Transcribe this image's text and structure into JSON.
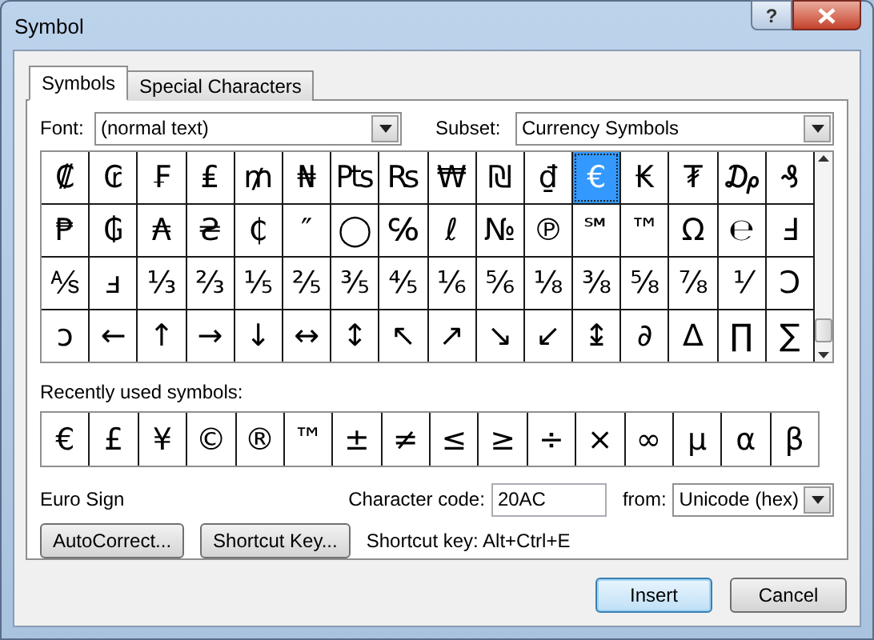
{
  "window": {
    "title": "Symbol",
    "help_button": "?"
  },
  "tabs": [
    {
      "label": "Symbols",
      "selected": true
    },
    {
      "label": "Special Characters",
      "selected": false
    }
  ],
  "font": {
    "label": "Font:",
    "value": "(normal text)"
  },
  "subset": {
    "label": "Subset:",
    "value": "Currency Symbols"
  },
  "symbols": [
    {
      "char": "₡",
      "selected": false
    },
    {
      "char": "₢",
      "selected": false
    },
    {
      "char": "₣",
      "selected": false
    },
    {
      "char": "₤",
      "selected": false
    },
    {
      "char": "₥",
      "selected": false
    },
    {
      "char": "₦",
      "selected": false
    },
    {
      "char": "₧",
      "selected": false
    },
    {
      "char": "₨",
      "selected": false
    },
    {
      "char": "₩",
      "selected": false
    },
    {
      "char": "₪",
      "selected": false
    },
    {
      "char": "₫",
      "selected": false
    },
    {
      "char": "€",
      "selected": true
    },
    {
      "char": "₭",
      "selected": false
    },
    {
      "char": "₮",
      "selected": false
    },
    {
      "char": "₯",
      "selected": false
    },
    {
      "char": "₰",
      "selected": false
    },
    {
      "char": "₱",
      "selected": false
    },
    {
      "char": "₲",
      "selected": false
    },
    {
      "char": "₳",
      "selected": false
    },
    {
      "char": "₴",
      "selected": false
    },
    {
      "char": "₵",
      "selected": false
    },
    {
      "char": "″",
      "selected": false
    },
    {
      "char": "◯",
      "selected": false
    },
    {
      "char": "℅",
      "selected": false
    },
    {
      "char": "ℓ",
      "selected": false
    },
    {
      "char": "№",
      "selected": false
    },
    {
      "char": "℗",
      "selected": false
    },
    {
      "char": "℠",
      "selected": false
    },
    {
      "char": "™",
      "selected": false
    },
    {
      "char": "Ω",
      "selected": false
    },
    {
      "char": "℮",
      "selected": false
    },
    {
      "char": "Ⅎ",
      "selected": false
    },
    {
      "char": "⅍",
      "selected": false
    },
    {
      "char": "ⅎ",
      "selected": false
    },
    {
      "char": "⅓",
      "selected": false
    },
    {
      "char": "⅔",
      "selected": false
    },
    {
      "char": "⅕",
      "selected": false
    },
    {
      "char": "⅖",
      "selected": false
    },
    {
      "char": "⅗",
      "selected": false
    },
    {
      "char": "⅘",
      "selected": false
    },
    {
      "char": "⅙",
      "selected": false
    },
    {
      "char": "⅚",
      "selected": false
    },
    {
      "char": "⅛",
      "selected": false
    },
    {
      "char": "⅜",
      "selected": false
    },
    {
      "char": "⅝",
      "selected": false
    },
    {
      "char": "⅞",
      "selected": false
    },
    {
      "char": "⅟",
      "selected": false
    },
    {
      "char": "Ↄ",
      "selected": false
    },
    {
      "char": "ↄ",
      "selected": false
    },
    {
      "char": "←",
      "selected": false
    },
    {
      "char": "↑",
      "selected": false
    },
    {
      "char": "→",
      "selected": false
    },
    {
      "char": "↓",
      "selected": false
    },
    {
      "char": "↔",
      "selected": false
    },
    {
      "char": "↕",
      "selected": false
    },
    {
      "char": "↖",
      "selected": false
    },
    {
      "char": "↗",
      "selected": false
    },
    {
      "char": "↘",
      "selected": false
    },
    {
      "char": "↙",
      "selected": false
    },
    {
      "char": "↨",
      "selected": false
    },
    {
      "char": "∂",
      "selected": false
    },
    {
      "char": "∆",
      "selected": false
    },
    {
      "char": "∏",
      "selected": false
    },
    {
      "char": "∑",
      "selected": false
    }
  ],
  "recent": {
    "label": "Recently used symbols:",
    "symbols": [
      "€",
      "£",
      "¥",
      "©",
      "®",
      "™",
      "±",
      "≠",
      "≤",
      "≥",
      "÷",
      "×",
      "∞",
      "µ",
      "α",
      "β"
    ]
  },
  "character_name": "Euro Sign",
  "character_code": {
    "label": "Character code:",
    "value": "20AC"
  },
  "from": {
    "label": "from:",
    "value": "Unicode (hex)"
  },
  "buttons": [
    "AutoCorrect...",
    "Shortcut Key..."
  ],
  "shortcut_text": "Shortcut key: Alt+Ctrl+E",
  "dialog_buttons": [
    {
      "label": "Insert",
      "default": true
    },
    {
      "label": "Cancel",
      "default": false
    }
  ]
}
